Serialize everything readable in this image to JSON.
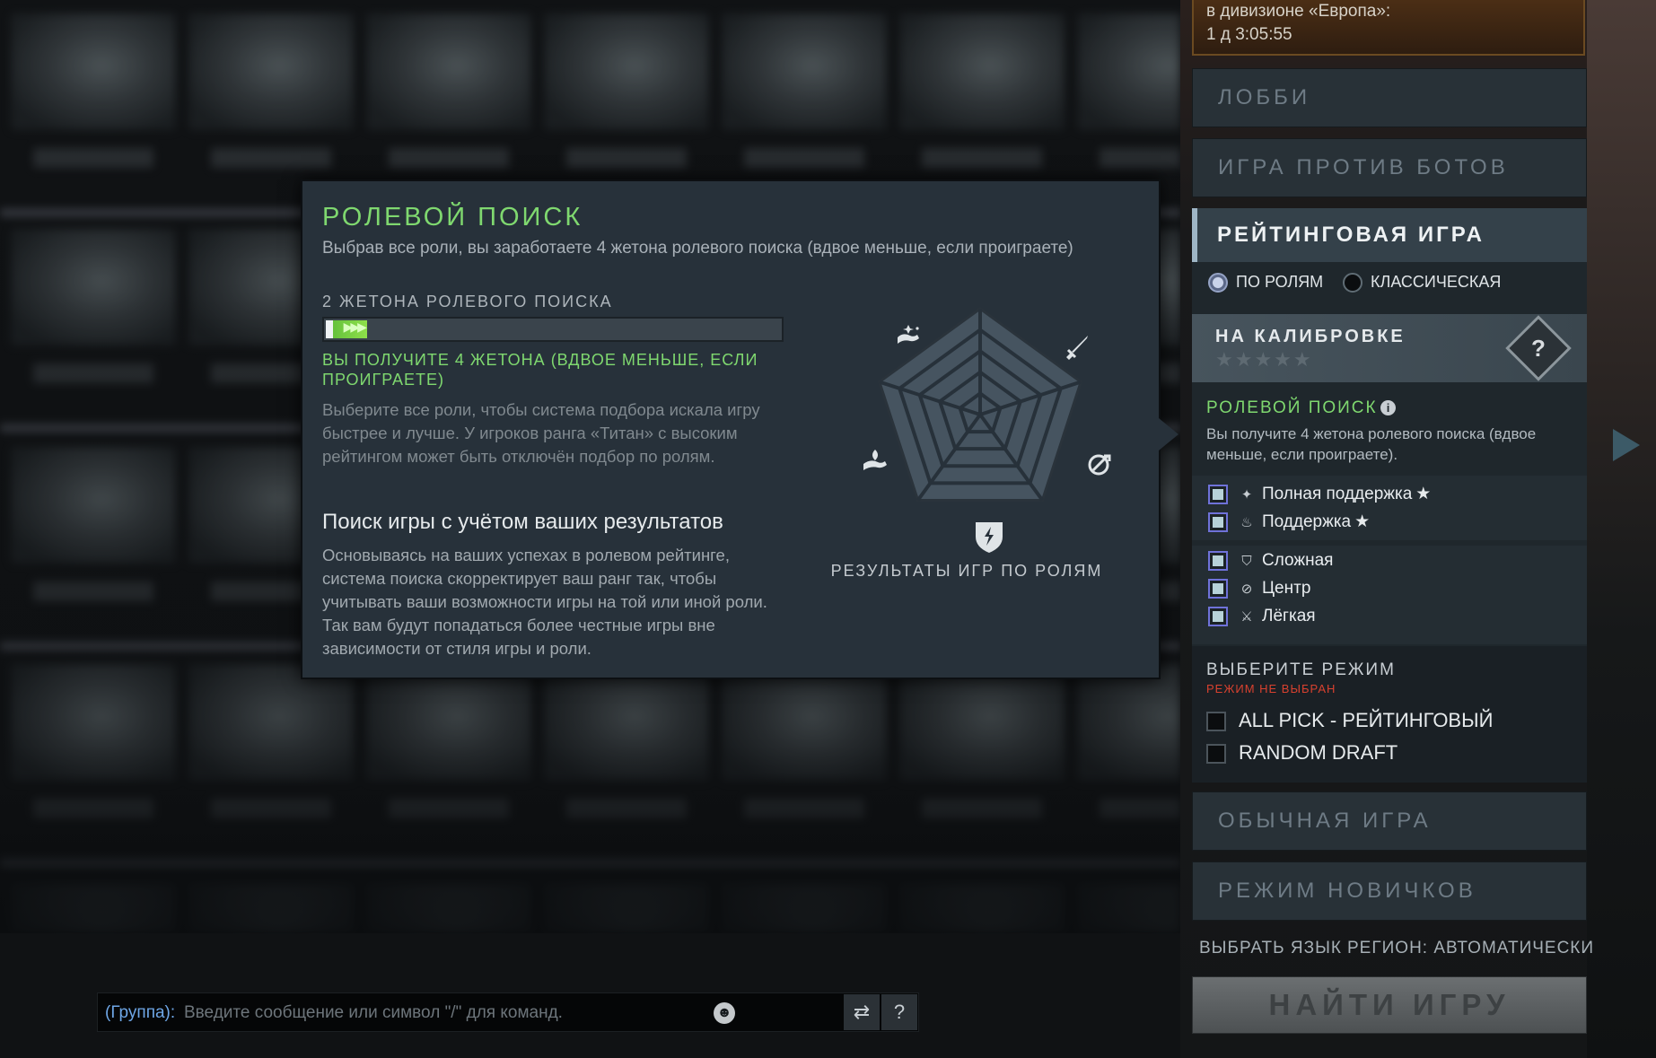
{
  "division": {
    "line1": "в дивизионе «Европа»:",
    "line2": "1 д 3:05:55"
  },
  "nav": {
    "lobby": "ЛОББИ",
    "bots": "ИГРА ПРОТИВ БОТОВ",
    "ranked": "РЕЙТИНГОВАЯ ИГРА",
    "unranked": "ОБЫЧНАЯ ИГРА",
    "newbie": "РЕЖИМ НОВИЧКОВ"
  },
  "ranked": {
    "radio_roles": "ПО РОЛЯМ",
    "radio_classic": "КЛАССИЧЕСКАЯ",
    "selected_radio": "ПО РОЛЯМ",
    "calibration_title": "НА КАЛИБРОВКЕ",
    "calibration_stars": "★★★★★",
    "calibration_badge": "?",
    "role_search_title": "РОЛЕВОЙ ПОИСК",
    "role_search_desc": "Вы получите 4 жетона ролевого поиска (вдвое меньше, если проиграете).",
    "roles": [
      {
        "label": "Полная поддержка",
        "icon": "hard-support-icon",
        "star": true,
        "checked": false
      },
      {
        "label": "Поддержка",
        "icon": "support-icon",
        "star": true,
        "checked": false
      },
      {
        "label": "Сложная",
        "icon": "offlane-icon",
        "star": false,
        "checked": false
      },
      {
        "label": "Центр",
        "icon": "mid-icon",
        "star": false,
        "checked": false
      },
      {
        "label": "Лёгкая",
        "icon": "carry-icon",
        "star": false,
        "checked": false
      }
    ],
    "mode_title": "ВЫБЕРИТЕ РЕЖИМ",
    "mode_warning": "РЕЖИМ НЕ ВЫБРАН",
    "modes": [
      "ALL PICK - РЕЙТИНГОВЫЙ",
      "RANDOM DRAFT"
    ]
  },
  "footer": {
    "language": "ВЫБРАТЬ ЯЗЫК",
    "region": "РЕГИОН: АВТОМАТИЧЕСКИ",
    "find_game": "НАЙТИ ИГРУ"
  },
  "popup": {
    "title": "РОЛЕВОЙ ПОИСК",
    "subtitle": "Выбрав все роли, вы заработаете 4 жетона ролевого поиска (вдвое меньше, если проиграете)",
    "tokens_label": "2 ЖЕТОНА РОЛЕВОГО ПОИСКА",
    "tokens_progress": 0.09,
    "bar_arrows": "▶▶▶",
    "green_note": "ВЫ ПОЛУЧИТЕ 4 ЖЕТОНА (ВДВОЕ МЕНЬШЕ, ЕСЛИ ПРОИГРАЕТЕ)",
    "gray_note": "Выберите все роли, чтобы система подбора искала игру быстрее и лучше. У игроков ранга «Титан» с высоким рейтингом может быть отключён подбор по ролям.",
    "heading": "Поиск игры с учётом ваших результатов",
    "paragraph": "Основываясь на ваших успехах в ролевом рейтинге, система поиска скорректирует ваш ранг так, чтобы учитывать ваши возможности игры на той или иной роли. Так вам будут попадаться более честные игры вне зависимости от стиля игры и роли.",
    "radar_caption": "РЕЗУЛЬТАТЫ ИГР ПО РОЛЯМ",
    "radar_icons": [
      "hard-support-icon",
      "carry-icon",
      "mid-icon",
      "offlane-icon",
      "support-icon"
    ]
  },
  "chat": {
    "prefix": "(Группа):",
    "placeholder": "Введите сообщение или символ \"/\" для команд.",
    "help": "?"
  },
  "colors": {
    "accent_green": "#7fd86f",
    "warning_red": "#d8412f",
    "popup_bg": "#27313a",
    "panel_bg": "#1f272c"
  }
}
